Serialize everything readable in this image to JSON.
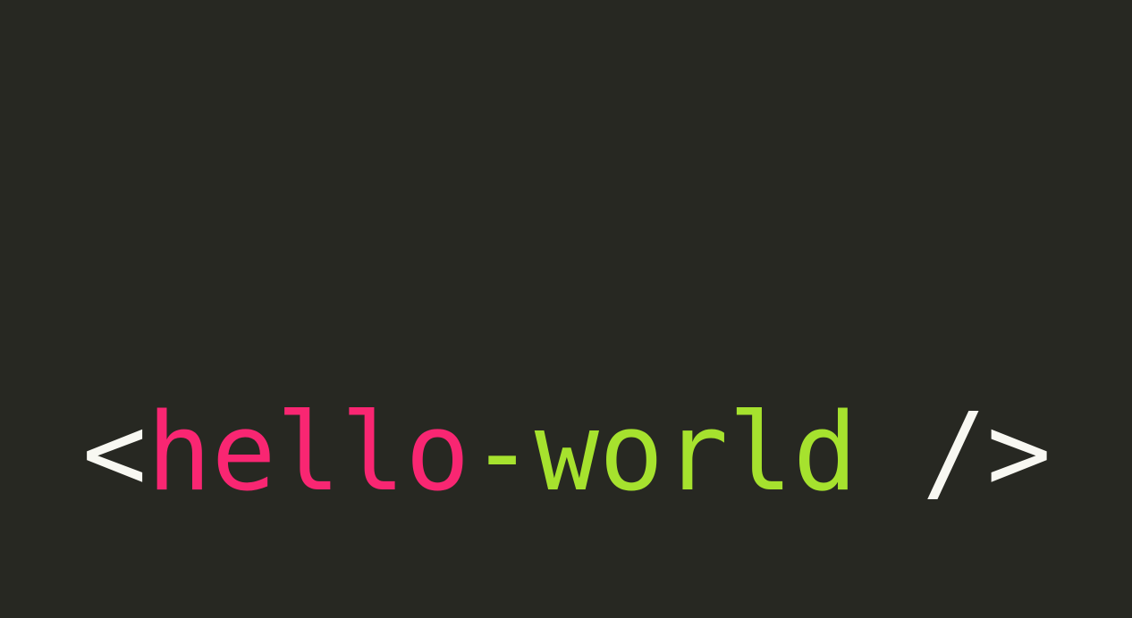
{
  "code": {
    "open_bracket": "<",
    "tag_part_1": "hello",
    "tag_part_2": "-world",
    "space": " ",
    "close_token": "/>"
  },
  "colors": {
    "background": "#272822",
    "bracket": "#f8f8f2",
    "tag_part_1": "#f92672",
    "tag_part_2": "#a6e22e",
    "close_token": "#f8f8f2"
  }
}
